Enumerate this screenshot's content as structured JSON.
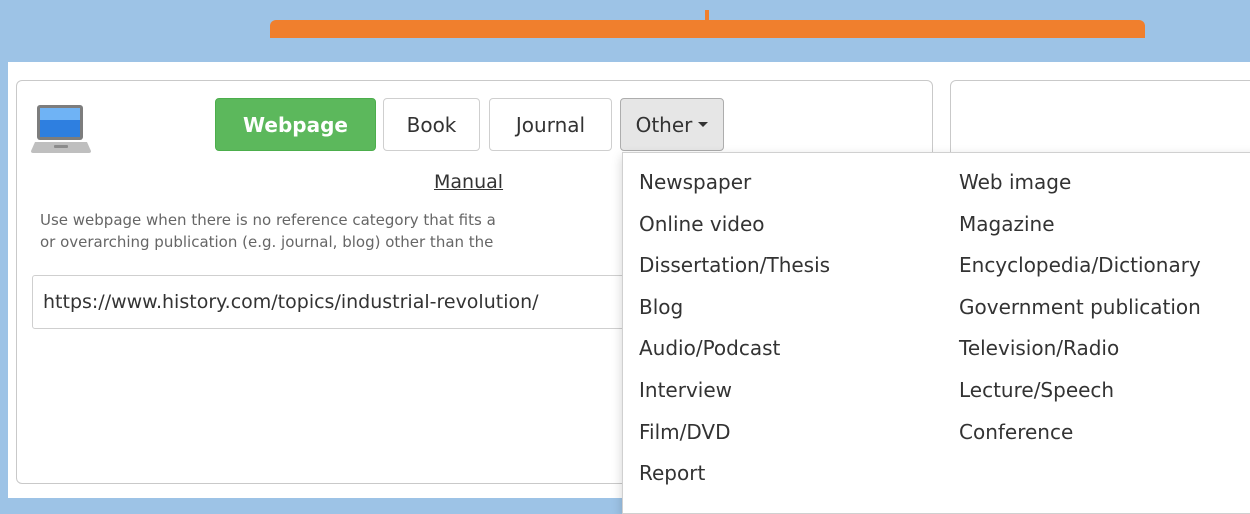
{
  "tabs": {
    "webpage": "Webpage",
    "book": "Book",
    "journal": "Journal",
    "other": "Other"
  },
  "manual_link": "Manual",
  "description": {
    "line1": "Use webpage when there is no reference category that fits a",
    "line2": "or overarching publication (e.g. journal, blog) other than the"
  },
  "url_input": {
    "value": "https://www.history.com/topics/industrial-revolution/"
  },
  "dropdown": {
    "col1": [
      "Newspaper",
      "Online video",
      "Dissertation/Thesis",
      "Blog",
      "Audio/Podcast",
      "Interview",
      "Film/DVD",
      "Report"
    ],
    "col2": [
      "Web image",
      "Magazine",
      "Encyclopedia/Dictionary",
      "Government publication",
      "Television/Radio",
      "Lecture/Speech",
      "Conference"
    ]
  },
  "colors": {
    "background": "#9dc3e6",
    "top_bar": "#f07f2d",
    "webpage_button": "#5cb85c"
  },
  "icons": {
    "source_type": "laptop-icon"
  }
}
